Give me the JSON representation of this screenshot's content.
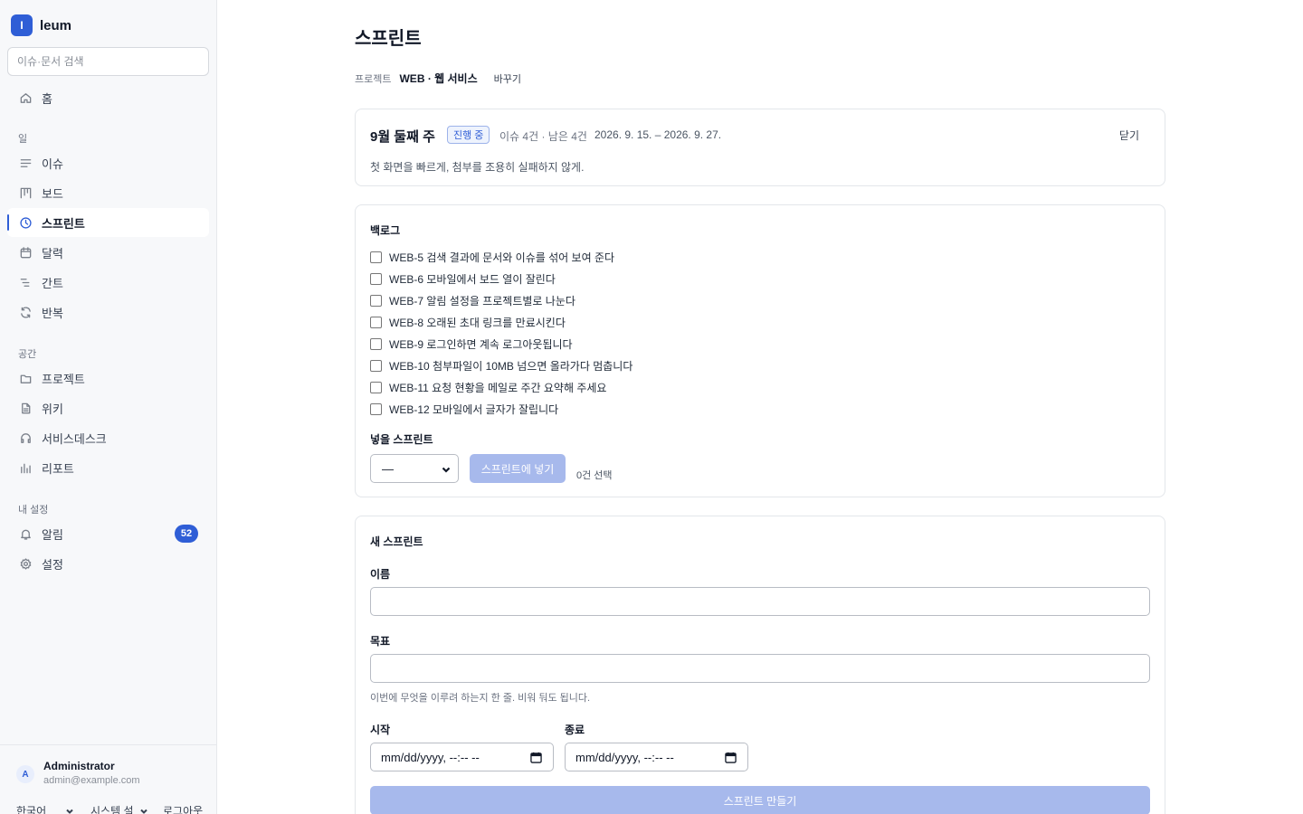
{
  "app": {
    "logo_letter": "I",
    "name": "leum"
  },
  "search": {
    "placeholder": "이슈·문서 검색"
  },
  "sidebar": {
    "home": {
      "label": "홈",
      "icon": "home-icon"
    },
    "section_work": "일",
    "work_items": [
      {
        "label": "이슈",
        "icon": "list-icon"
      },
      {
        "label": "보드",
        "icon": "board-icon"
      },
      {
        "label": "스프린트",
        "icon": "clock-icon",
        "active": true
      },
      {
        "label": "달력",
        "icon": "calendar-icon"
      },
      {
        "label": "간트",
        "icon": "gantt-icon"
      },
      {
        "label": "반복",
        "icon": "repeat-icon"
      }
    ],
    "section_space": "공간",
    "space_items": [
      {
        "label": "프로젝트",
        "icon": "folder-icon"
      },
      {
        "label": "위키",
        "icon": "document-icon"
      },
      {
        "label": "서비스데스크",
        "icon": "headset-icon"
      },
      {
        "label": "리포트",
        "icon": "bar-chart-icon"
      }
    ],
    "section_settings": "내 설정",
    "settings_items": [
      {
        "label": "알림",
        "icon": "bell-icon",
        "badge": "52"
      },
      {
        "label": "설정",
        "icon": "gear-icon"
      }
    ]
  },
  "user": {
    "initial": "A",
    "name": "Administrator",
    "email": "admin@example.com"
  },
  "footer": {
    "language": "한국어",
    "theme": "시스템 설",
    "logout": "로그아웃"
  },
  "page": {
    "title": "스프린트"
  },
  "project": {
    "label": "프로젝트",
    "value": "WEB · 웹 서비스",
    "change": "바꾸기"
  },
  "sprint": {
    "name": "9월 둘째 주",
    "status": "진행 중",
    "meta": "이슈 4건 · 남은 4건",
    "dates": "2026. 9. 15. – 2026. 9. 27.",
    "close": "닫기",
    "goal": "첫 화면을 빠르게, 첨부를 조용히 실패하지 않게."
  },
  "backlog": {
    "title": "백로그",
    "issues": [
      {
        "key": "WEB-5",
        "title": "검색 결과에 문서와 이슈를 섞어 보여 준다"
      },
      {
        "key": "WEB-6",
        "title": "모바일에서 보드 열이 잘린다"
      },
      {
        "key": "WEB-7",
        "title": "알림 설정을 프로젝트별로 나눈다"
      },
      {
        "key": "WEB-8",
        "title": "오래된 초대 링크를 만료시킨다"
      },
      {
        "key": "WEB-9",
        "title": "로그인하면 계속 로그아웃됩니다"
      },
      {
        "key": "WEB-10",
        "title": "첨부파일이 10MB 넘으면 올라가다 멈춥니다"
      },
      {
        "key": "WEB-11",
        "title": "요청 현황을 메일로 주간 요약해 주세요"
      },
      {
        "key": "WEB-12",
        "title": "모바일에서 글자가 잘립니다"
      }
    ],
    "target_label": "넣을 스프린트",
    "target_value": "—",
    "add_button": "스프린트에 넣기",
    "selected_count": "0건 선택"
  },
  "new_sprint": {
    "title": "새 스프린트",
    "name_label": "이름",
    "goal_label": "목표",
    "goal_hint": "이번에 무엇을 이루려 하는지 한 줄. 비워 둬도 됩니다.",
    "start_label": "시작",
    "end_label": "종료",
    "date_placeholder": "mm/dd/yyyy, --:-- --",
    "create_button": "스프린트 만들기"
  },
  "colors": {
    "accent": "#2f5ed6",
    "disabled_button": "#a7b9ec",
    "sidebar_bg": "#f7f8fa"
  }
}
